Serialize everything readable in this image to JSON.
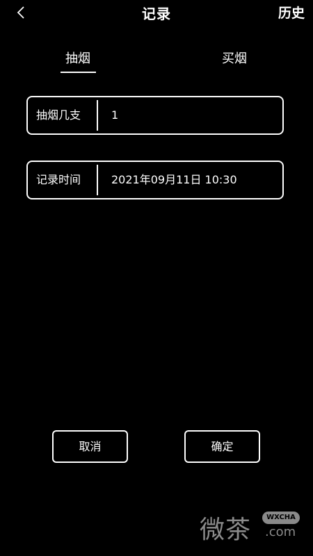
{
  "header": {
    "back_icon": "chevron-left-icon",
    "title": "记录",
    "history_label": "历史"
  },
  "tabs": [
    {
      "label": "抽烟",
      "active": true
    },
    {
      "label": "买烟",
      "active": false
    }
  ],
  "form": {
    "count": {
      "label": "抽烟几支",
      "value": "1"
    },
    "time": {
      "label": "记录时间",
      "value": "2021年09月11日 10:30"
    }
  },
  "actions": {
    "cancel_label": "取消",
    "confirm_label": "确定"
  },
  "watermark": {
    "chars": "微茶",
    "badge": "WXCHA",
    "domain": ".com"
  },
  "colors": {
    "background": "#000000",
    "foreground": "#ffffff",
    "watermark": "#8a8a8a"
  }
}
